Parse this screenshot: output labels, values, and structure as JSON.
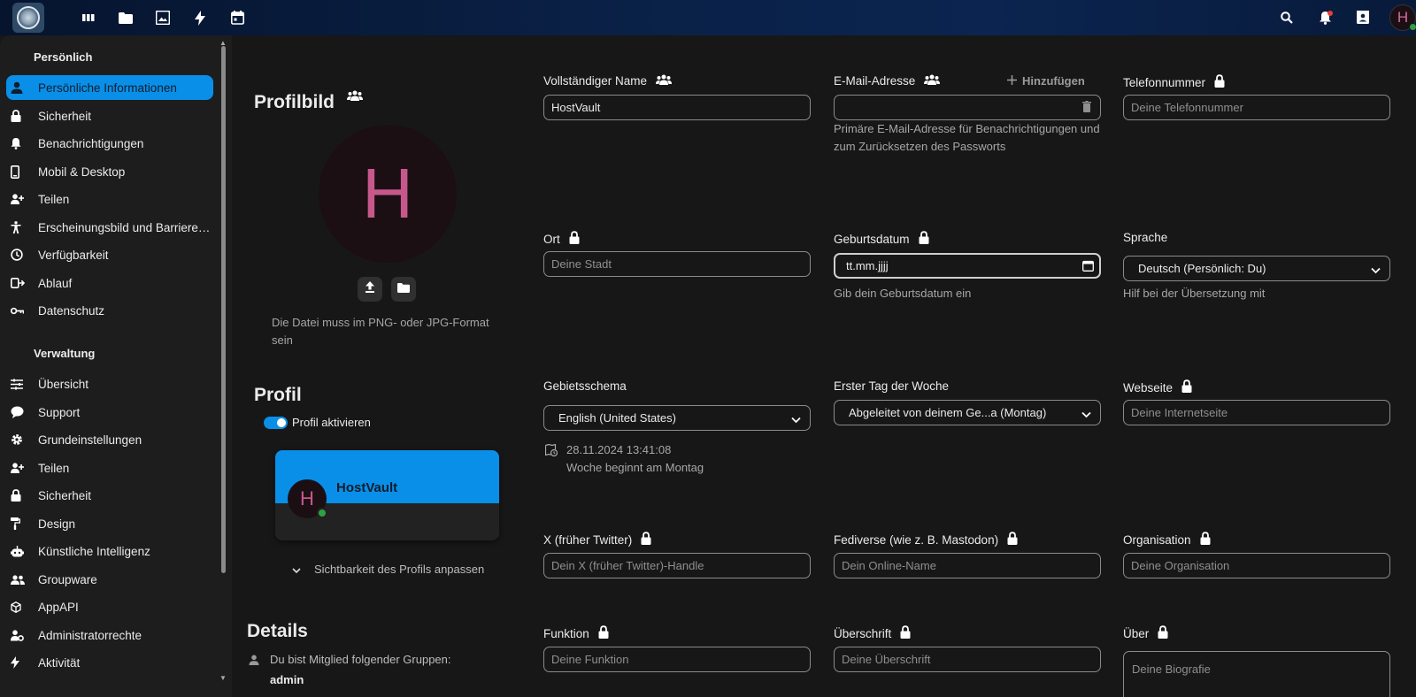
{
  "topbar": {
    "apps": [
      {
        "name": "dashboard-icon"
      },
      {
        "name": "files-icon"
      },
      {
        "name": "photos-icon"
      },
      {
        "name": "activity-icon"
      },
      {
        "name": "calendar-icon"
      }
    ],
    "avatar_initial": "H",
    "icons": [
      "search-icon",
      "notifications-icon",
      "contacts-icon"
    ]
  },
  "sidebar": {
    "personal_heading": "Persönlich",
    "personal_items": [
      {
        "label": "Persönliche Informationen",
        "icon": "person-icon",
        "active": true
      },
      {
        "label": "Sicherheit",
        "icon": "lock-icon"
      },
      {
        "label": "Benachrichtigungen",
        "icon": "bell-icon"
      },
      {
        "label": "Mobil & Desktop",
        "icon": "phone-icon"
      },
      {
        "label": "Teilen",
        "icon": "share-icon"
      },
      {
        "label": "Erscheinungsbild und Barrierefreiheit",
        "icon": "accessibility-icon"
      },
      {
        "label": "Verfügbarkeit",
        "icon": "clock-icon"
      },
      {
        "label": "Ablauf",
        "icon": "flow-icon"
      },
      {
        "label": "Datenschutz",
        "icon": "key-icon"
      }
    ],
    "admin_heading": "Verwaltung",
    "admin_items": [
      {
        "label": "Übersicht",
        "icon": "overview-icon"
      },
      {
        "label": "Support",
        "icon": "support-icon"
      },
      {
        "label": "Grundeinstellungen",
        "icon": "cog-icon"
      },
      {
        "label": "Teilen",
        "icon": "share-icon"
      },
      {
        "label": "Sicherheit",
        "icon": "lock-icon"
      },
      {
        "label": "Design",
        "icon": "paint-roller-icon"
      },
      {
        "label": "Künstliche Intelligenz",
        "icon": "robot-icon"
      },
      {
        "label": "Groupware",
        "icon": "groups-icon"
      },
      {
        "label": "AppAPI",
        "icon": "cube-icon"
      },
      {
        "label": "Administratorrechte",
        "icon": "admin-icon"
      },
      {
        "label": "Aktivität",
        "icon": "lightning-icon"
      }
    ]
  },
  "profile_picture": {
    "title": "Profilbild",
    "initial": "H",
    "hint": "Die Datei muss im PNG- oder JPG-Format sein"
  },
  "profile": {
    "title": "Profil",
    "toggle_label": "Profil aktivieren",
    "toggle_on": true,
    "card_name": "HostVault",
    "card_initial": "H",
    "visibility_label": "Sichtbarkeit des Profils anpassen"
  },
  "details": {
    "title": "Details",
    "groups_text": "Du bist Mitglied folgender Gruppen:",
    "group": "admin"
  },
  "fields": {
    "full_name": {
      "label": "Vollständiger Name",
      "value": "HostVault"
    },
    "email": {
      "label": "E-Mail-Adresse",
      "add_label": "Hinzufügen",
      "value": "",
      "helper": "Primäre E-Mail-Adresse für Benachrichtigungen und zum Zurücksetzen des Passworts"
    },
    "phone": {
      "label": "Telefonnummer",
      "placeholder": "Deine Telefonnummer"
    },
    "city": {
      "label": "Ort",
      "placeholder": "Deine Stadt"
    },
    "birthday": {
      "label": "Geburtsdatum",
      "value": "tt.mm.jjjj",
      "helper": "Gib dein Geburtsdatum ein"
    },
    "language": {
      "label": "Sprache",
      "value": "Deutsch (Persönlich: Du)",
      "helper": "Hilf bei der Übersetzung mit"
    },
    "locale": {
      "label": "Gebietsschema",
      "value": "English (United States)",
      "time": "28.11.2024 13:41:08",
      "week_start": "Woche beginnt am Montag"
    },
    "first_day": {
      "label": "Erster Tag der Woche",
      "value": "Abgeleitet von deinem Ge...a (Montag)"
    },
    "website": {
      "label": "Webseite",
      "placeholder": "Deine Internetseite"
    },
    "twitter": {
      "label": "X (früher Twitter)",
      "placeholder": "Dein X (früher Twitter)-Handle"
    },
    "fediverse": {
      "label": "Fediverse (wie z. B. Mastodon)",
      "placeholder": "Dein Online-Name"
    },
    "organisation": {
      "label": "Organisation",
      "placeholder": "Deine Organisation"
    },
    "role": {
      "label": "Funktion",
      "placeholder": "Deine Funktion"
    },
    "headline": {
      "label": "Überschrift",
      "placeholder": "Deine Überschrift"
    },
    "about": {
      "label": "Über",
      "placeholder": "Deine Biografie"
    }
  },
  "colors": {
    "accent": "#0a8fe8",
    "avatar_text": "#c7588c",
    "online": "#2fa043"
  }
}
